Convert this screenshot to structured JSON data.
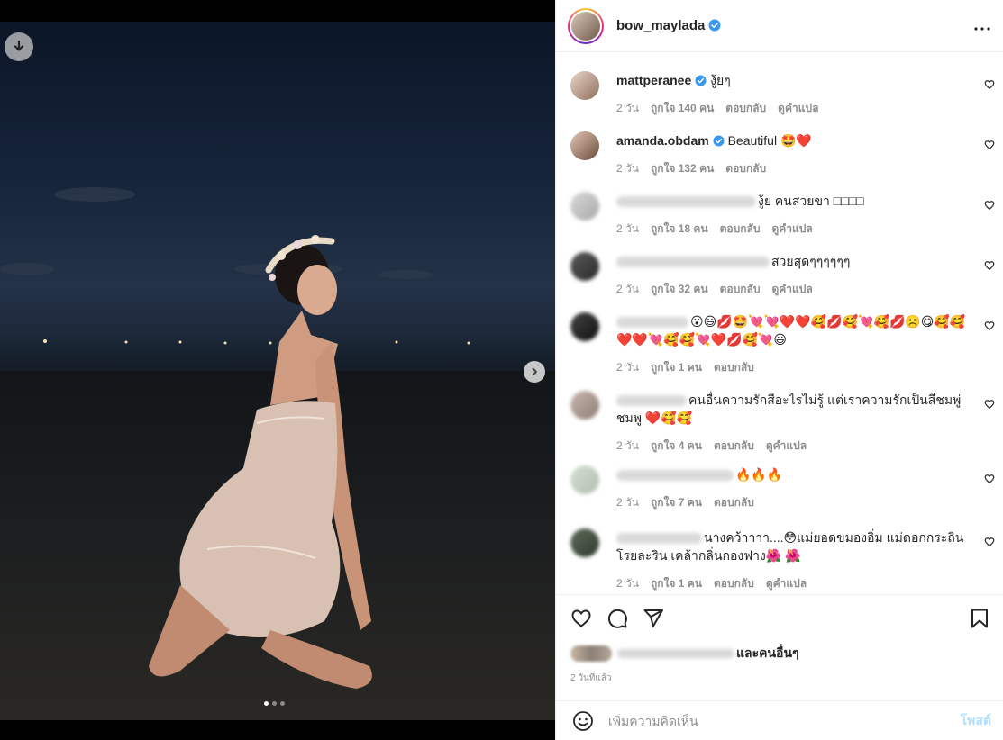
{
  "post": {
    "username": "bow_maylada",
    "time_ago": "2 วันที่แล้ว",
    "likes_suffix": "และคนอื่นๆ",
    "carousel_count": 3
  },
  "comments": [
    {
      "user": "mattperanee",
      "verified": true,
      "blurred": false,
      "text": "งู้ยๆ",
      "age": "2 วัน",
      "likes": "ถูกใจ 140 คน",
      "reply": "ตอบกลับ",
      "translate": "ดูคำแปล"
    },
    {
      "user": "amanda.obdam",
      "verified": true,
      "blurred": false,
      "text": "Beautiful 🤩❤️",
      "age": "2 วัน",
      "likes": "ถูกใจ 132 คน",
      "reply": "ตอบกลับ",
      "translate": ""
    },
    {
      "user": "",
      "verified": false,
      "blurred": true,
      "text": "งู้ย คนสวยขา □□□□",
      "age": "2 วัน",
      "likes": "ถูกใจ 18 คน",
      "reply": "ตอบกลับ",
      "translate": "ดูคำแปล"
    },
    {
      "user": "",
      "verified": false,
      "blurred": true,
      "text": "สวยสุดๆๆๆๆๆๆ",
      "age": "2 วัน",
      "likes": "ถูกใจ 32 คน",
      "reply": "ตอบกลับ",
      "translate": "ดูคำแปล"
    },
    {
      "user": "",
      "verified": false,
      "blurred": true,
      "text": "😮😃💋🤩💘💘❤️❤️🥰💋🥰💘🥰💋☹️😋🥰🥰❤️❤️💘🥰🥰💘❤️💋🥰💘😃",
      "age": "2 วัน",
      "likes": "ถูกใจ 1 คน",
      "reply": "ตอบกลับ",
      "translate": ""
    },
    {
      "user": "",
      "verified": false,
      "blurred": true,
      "text": "คนอื่นความรักสีอะไรไม่รู้ แต่เราความรักเป็นสีชมพู่ ชมพู ❤️🥰🥰",
      "age": "2 วัน",
      "likes": "ถูกใจ 4 คน",
      "reply": "ตอบกลับ",
      "translate": "ดูคำแปล"
    },
    {
      "user": "",
      "verified": false,
      "blurred": true,
      "text": "🔥🔥🔥",
      "age": "2 วัน",
      "likes": "ถูกใจ 7 คน",
      "reply": "ตอบกลับ",
      "translate": ""
    },
    {
      "user": "",
      "verified": false,
      "blurred": true,
      "text": "นางคว้าาาา....😳แม่ยอดขมองอิ่ม แม่ดอกกระถิน โรยละริน เคล้ากลิ่นกองฟาง🌺 🌺",
      "age": "2 วัน",
      "likes": "ถูกใจ 1 คน",
      "reply": "ตอบกลับ",
      "translate": "ดูคำแปล"
    }
  ],
  "add_comment": {
    "placeholder": "เพิ่มความคิดเห็น",
    "post_label": "โพสต์"
  },
  "colors": {
    "verified": "#3897f0",
    "muted": "#8e8e8e",
    "post_disabled": "#b2dffc"
  }
}
